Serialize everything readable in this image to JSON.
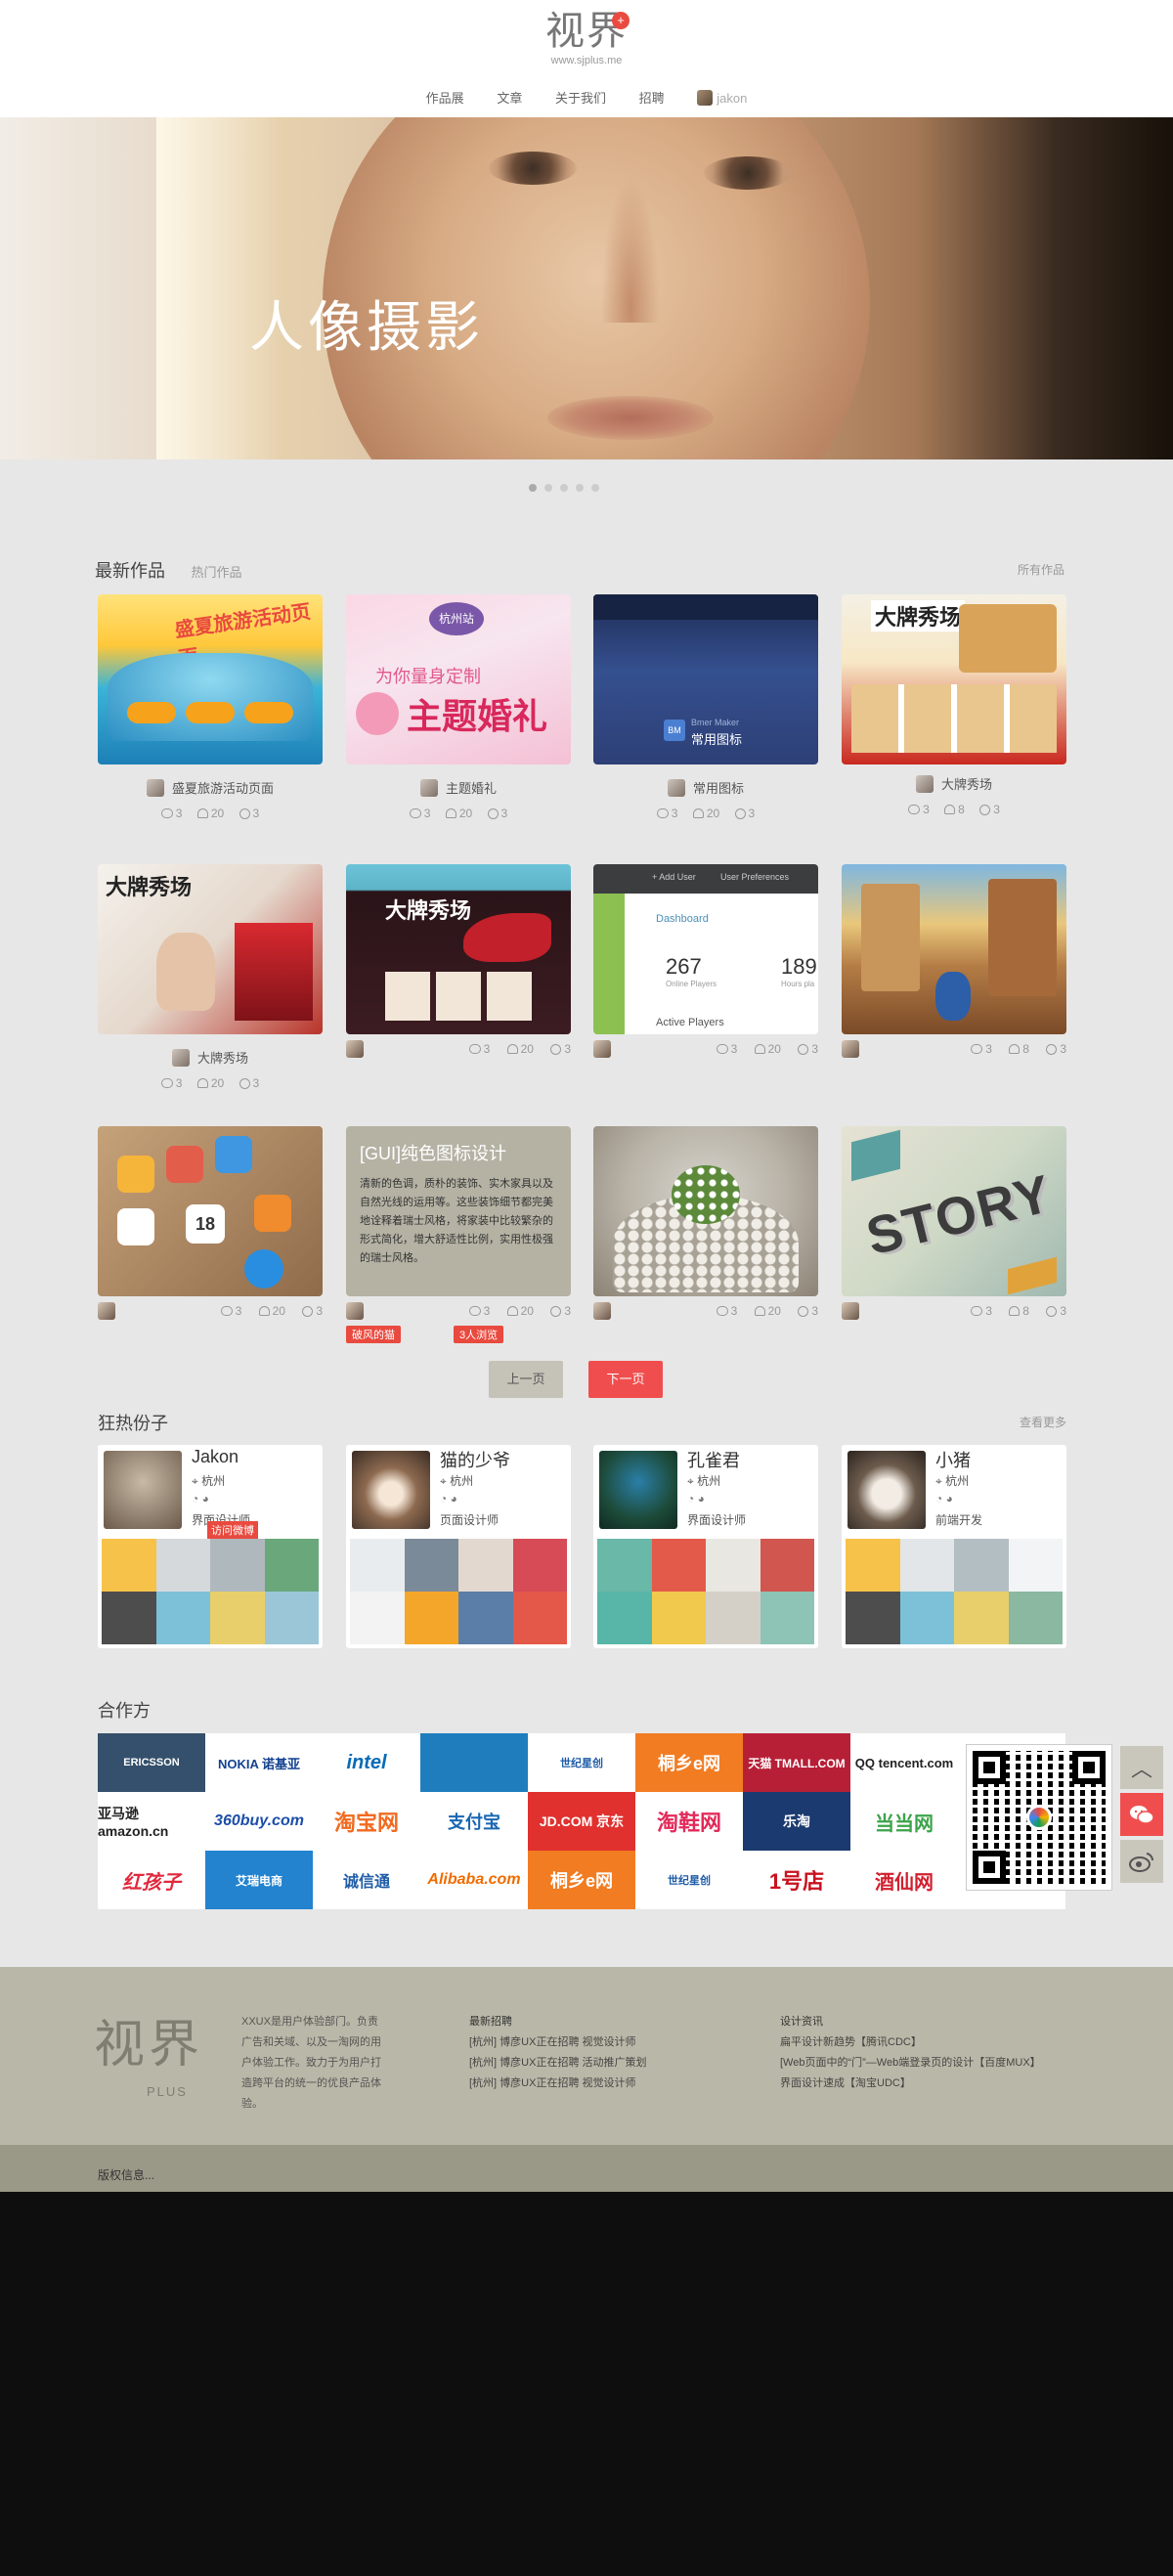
{
  "brand": {
    "logo_text": "视界",
    "plus": "+",
    "url": "www.sjplus.me",
    "footer_logo": "视界",
    "footer_sub": "PLUS"
  },
  "nav": {
    "items": [
      "作品展",
      "文章",
      "关于我们",
      "招聘"
    ],
    "user": "jakon"
  },
  "hero": {
    "title": "人像摄影",
    "dots": 5,
    "active_dot": 0
  },
  "works": {
    "title": "最新作品",
    "tab": "热门作品",
    "more": "所有作品",
    "items": [
      {
        "name": "盛夏旅游活动页面",
        "views": "3",
        "likes": "20",
        "comments": "3"
      },
      {
        "name": "主题婚礼",
        "views": "3",
        "likes": "20",
        "comments": "3"
      },
      {
        "name": "常用图标",
        "views": "3",
        "likes": "20",
        "comments": "3"
      },
      {
        "name": "大牌秀场",
        "views": "3",
        "likes": "8",
        "comments": "3"
      },
      {
        "name": "大牌秀场",
        "views": "3",
        "likes": "20",
        "comments": "3"
      },
      {
        "name": "",
        "views": "3",
        "likes": "20",
        "comments": "3"
      },
      {
        "name": "",
        "views": "3",
        "likes": "20",
        "comments": "3"
      },
      {
        "name": "",
        "views": "3",
        "likes": "8",
        "comments": "3"
      },
      {
        "name": "",
        "views": "3",
        "likes": "20",
        "comments": "3"
      },
      {
        "name": "",
        "views": "3",
        "likes": "20",
        "comments": "3",
        "tags": [
          "破风的猫",
          "3人浏览"
        ]
      },
      {
        "name": "",
        "views": "3",
        "likes": "20",
        "comments": "3"
      },
      {
        "name": "",
        "views": "3",
        "likes": "8",
        "comments": "3"
      }
    ],
    "thumb_texts": {
      "travel": "盛夏旅游活动页面",
      "wedding_city": "杭州站",
      "wedding_title": "主题婚礼",
      "wedding_tagline": "为你量身定制",
      "icons_label": "常用图标",
      "icons_sub": "Bmer Maker",
      "show": "大牌秀场",
      "dash_title": "Dashboard",
      "dash_num1": "267",
      "dash_num2": "189",
      "dash_label1": "Online Players",
      "dash_label2": "Hours pla",
      "dash_active": "Active Players",
      "dash_add": "+ Add User",
      "dash_pref": "User Preferences",
      "gui_title": "[GUI]纯色图标设计",
      "gui_body": "清新的色调，质朴的装饰、实木家具以及自然光线的运用等。这些装饰细节都完美地诠释着瑞士风格，将家装中比较繁杂的形式简化，增大舒适性比例，实用性极强的瑞士风格。",
      "calendar": "18",
      "story": "STORY"
    }
  },
  "pager": {
    "prev": "上一页",
    "next": "下一页"
  },
  "members": {
    "title": "狂热份子",
    "more": "查看更多",
    "items": [
      {
        "name": "Jakon",
        "city": "杭州",
        "role": "界面设计师",
        "visit": "访问微博"
      },
      {
        "name": "猫的少爷",
        "city": "杭州",
        "role": "页面设计师"
      },
      {
        "name": "孔雀君",
        "city": "杭州",
        "role": "界面设计师"
      },
      {
        "name": "小猪",
        "city": "杭州",
        "role": "前端开发"
      }
    ]
  },
  "partners": {
    "title": "合作方",
    "items": [
      "ERICSSON",
      "NOKIA 诺基亚",
      "intel",
      "",
      "世纪星创",
      "桐乡e网",
      "天猫 TMALL.COM",
      "QQ tencent.com",
      "",
      "亚马逊 amazon.cn",
      "360buy.com",
      "淘宝网",
      "支付宝",
      "JD.COM 京东",
      "淘鞋网",
      "乐淘",
      "当当网",
      "",
      "红孩子",
      "艾瑞电商",
      "诚信通",
      "Alibaba.com",
      "桐乡e网",
      "世纪星创",
      "1号店",
      "酒仙网",
      ""
    ]
  },
  "side": {
    "top": "︿",
    "wechat": "wechat",
    "weibo": "weibo"
  },
  "footer": {
    "desc": "XXUX是用户体验部门。负责广告和关域、以及一淘网的用户体验工作。致力于为用户打造跨平台的统一的优良产品体验。",
    "col1_title": "最新招聘",
    "col1": [
      "[杭州] 博彦UX正在招聘 视觉设计师",
      "[杭州] 博彦UX正在招聘 活动推广策划",
      "[杭州] 博彦UX正在招聘 视觉设计师"
    ],
    "col2_title": "设计资讯",
    "col2": [
      "扁平设计新趋势【腾讯CDC】",
      "[Web页面中的“门”—Web端登录页的设计【百度MUX】",
      "界面设计速成【淘宝UDC】"
    ],
    "copyright": "版权信息..."
  },
  "colors": {
    "accent": "#f04e4e",
    "footer": "#b9b8a8",
    "bg": "#e7e7e7"
  }
}
